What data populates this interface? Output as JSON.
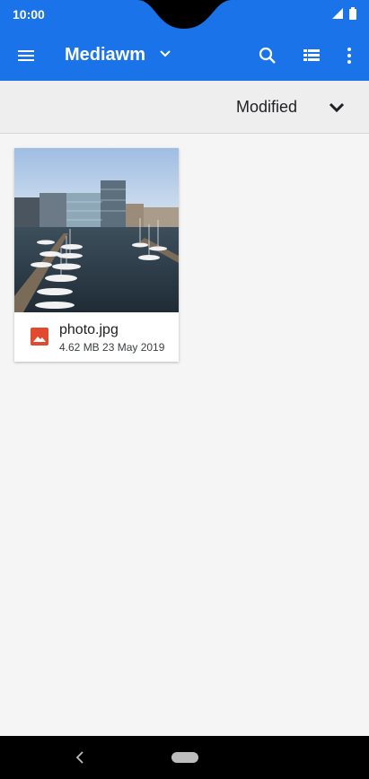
{
  "status_bar": {
    "time": "10:00"
  },
  "toolbar": {
    "title": "Mediawm",
    "icons": [
      "menu-icon",
      "chevron-down-icon",
      "search-icon",
      "list-view-icon",
      "more-vert-icon"
    ]
  },
  "sort": {
    "label": "Modified"
  },
  "files": [
    {
      "name": "photo.jpg",
      "size": "4.62 MB",
      "date": "23 May 2019",
      "meta": "4.62 MB 23 May 2019",
      "type_icon": "image-icon"
    }
  ],
  "colors": {
    "toolbar": "#1a73e8",
    "image_icon": "#e24a2f",
    "background": "#f5f5f5"
  }
}
